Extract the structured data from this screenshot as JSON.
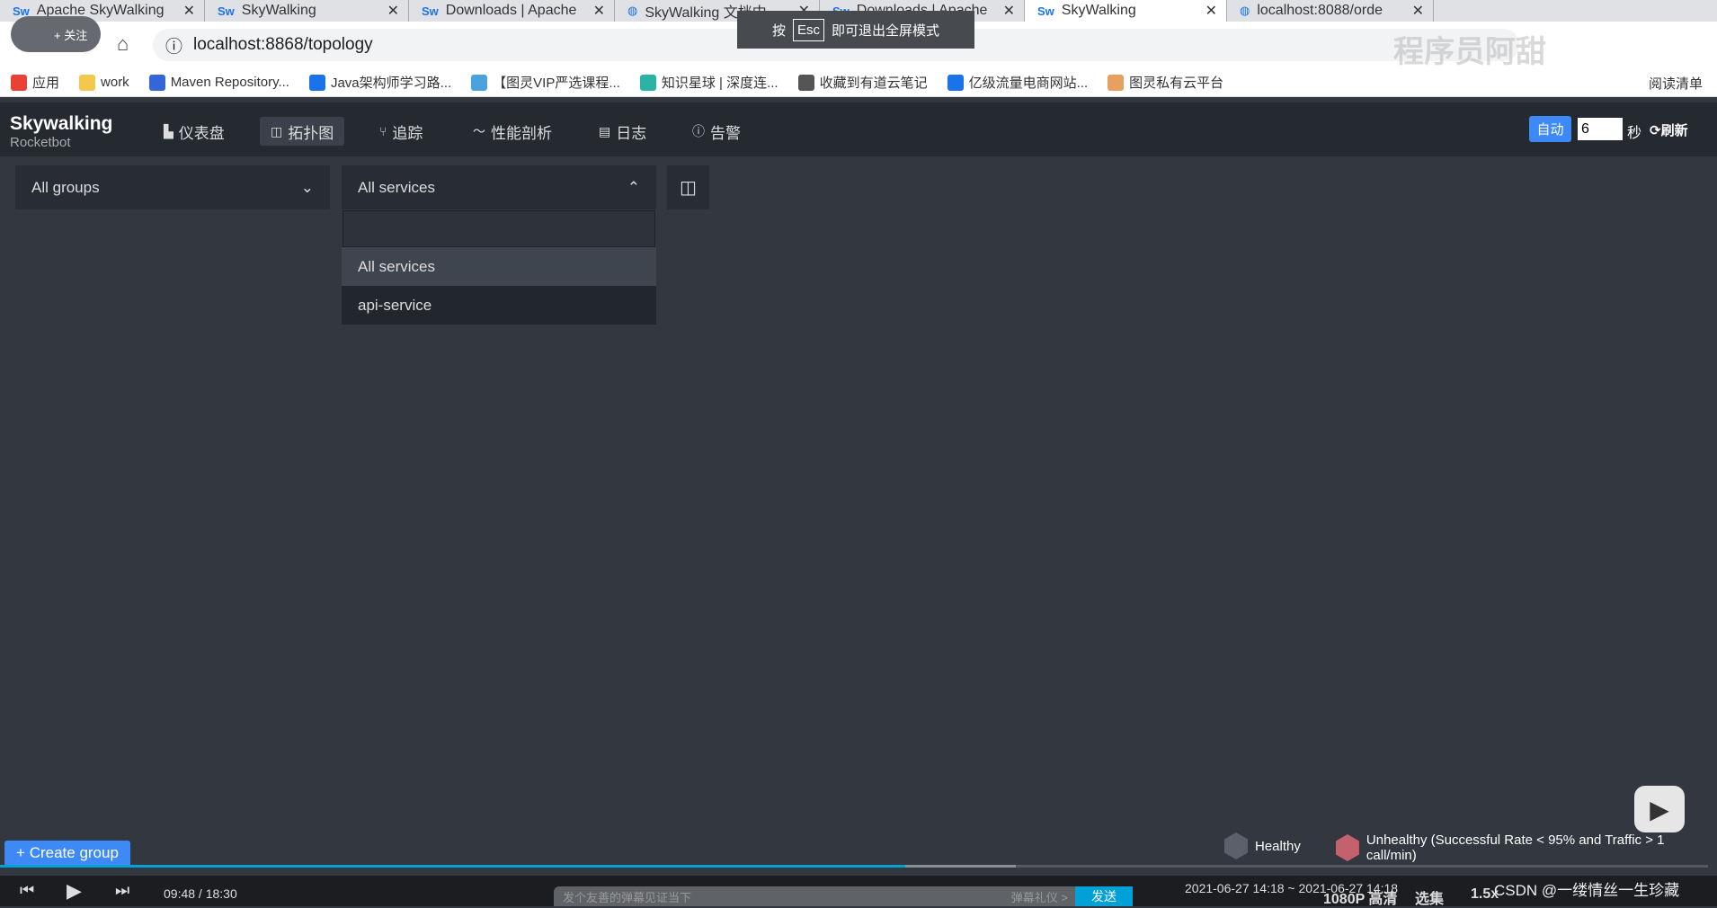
{
  "browser": {
    "tabs": [
      {
        "title": "Apache SkyWalking",
        "icon": "sw"
      },
      {
        "title": "SkyWalking",
        "icon": "sw"
      },
      {
        "title": "Downloads | Apache",
        "icon": "sw"
      },
      {
        "title": "SkyWalking 文档中",
        "icon": "globe"
      },
      {
        "title": "Downloads | Apache",
        "icon": "sw"
      },
      {
        "title": "SkyWalking",
        "icon": "sw",
        "active": true
      },
      {
        "title": "localhost:8088/orde",
        "icon": "globe"
      }
    ],
    "url": "localhost:8868/topology",
    "follow_label": "+ 关注",
    "esc_hint": {
      "prefix": "按",
      "key": "Esc",
      "suffix": "即可退出全屏模式"
    },
    "bookmarks": [
      "应用",
      "work",
      "Maven Repository...",
      "Java架构师学习路...",
      "【图灵VIP严选课程...",
      "知识星球 | 深度连...",
      "收藏到有道云笔记",
      "亿级流量电商网站...",
      "图灵私有云平台"
    ],
    "reading_list": "阅读清单",
    "watermark": "程序员阿甜"
  },
  "app": {
    "logo": {
      "title": "Skywalking",
      "subtitle": "Rocketbot"
    },
    "nav": [
      {
        "label": "仪表盘",
        "icon": "chart-icon"
      },
      {
        "label": "拓扑图",
        "icon": "topology-icon",
        "active": true
      },
      {
        "label": "追踪",
        "icon": "trace-icon"
      },
      {
        "label": "性能剖析",
        "icon": "profile-icon"
      },
      {
        "label": "日志",
        "icon": "log-icon"
      },
      {
        "label": "告警",
        "icon": "alarm-icon"
      }
    ],
    "auto_label": "自动",
    "interval": "6",
    "seconds_label": "秒",
    "refresh_label": "刷新"
  },
  "topology": {
    "group_select": "All groups",
    "service_select": "All services",
    "search_value": "",
    "service_options": [
      "All services",
      "api-service"
    ],
    "create_group": "+ Create group",
    "legend": {
      "healthy": "Healthy",
      "unhealthy": "Unhealthy (Successful Rate < 95% and Traffic > 1 call/min)",
      "healthy_color": "#5b616b",
      "unhealthy_color": "#c4616f"
    }
  },
  "player": {
    "time": "09:48 / 18:30",
    "danmu_placeholder": "发个友善的弹幕见证当下",
    "etiquette": "弹幕礼仪 >",
    "send": "发送",
    "range": "2021-06-27 14:18 ~ 2021-06-27 14:18",
    "quality": "1080P 高清",
    "episodes": "选集",
    "speed": "1.5x",
    "csdn": "CSDN @一缕情丝一生珍藏",
    "progress": 0.53
  }
}
